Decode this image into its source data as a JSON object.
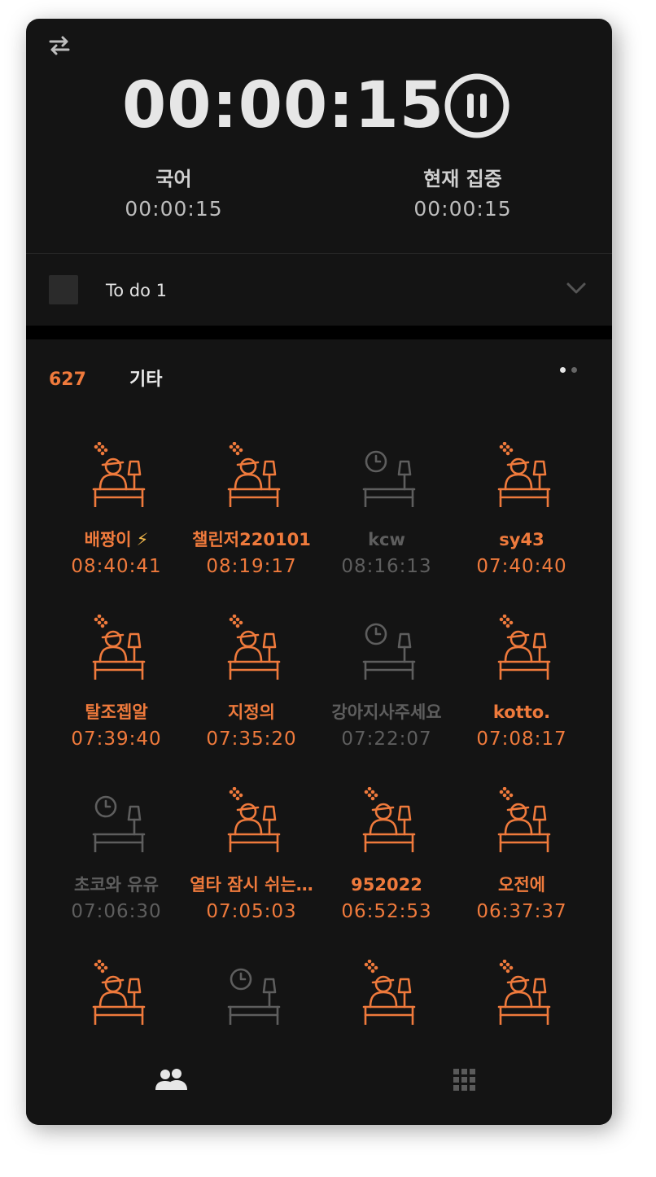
{
  "timer": {
    "main": "00:00:15",
    "subject_label": "국어",
    "subject_time": "00:00:15",
    "focus_label": "현재 집중",
    "focus_time": "00:00:15"
  },
  "todo": {
    "label": "To do 1"
  },
  "group": {
    "count": "627",
    "name": "기타"
  },
  "members": [
    {
      "name": "배짱이",
      "badge": "⚡",
      "time": "08:40:41",
      "active": true
    },
    {
      "name": "챌린저220101",
      "time": "08:19:17",
      "active": true
    },
    {
      "name": "kcw",
      "time": "08:16:13",
      "active": false
    },
    {
      "name": "sy43",
      "time": "07:40:40",
      "active": true
    },
    {
      "name": "탈조젭알",
      "time": "07:39:40",
      "active": true
    },
    {
      "name": "지정의",
      "time": "07:35:20",
      "active": true
    },
    {
      "name": "강아지사주세요",
      "time": "07:22:07",
      "active": false
    },
    {
      "name": "kotto.",
      "time": "07:08:17",
      "active": true
    },
    {
      "name": "초코와 유유",
      "time": "07:06:30",
      "active": false
    },
    {
      "name": "열타 잠시 쉬는…",
      "time": "07:05:03",
      "active": true
    },
    {
      "name": "952022",
      "time": "06:52:53",
      "active": true
    },
    {
      "name": "오전에",
      "time": "06:37:37",
      "active": true
    },
    {
      "name": "",
      "time": "",
      "active": true
    },
    {
      "name": "",
      "time": "",
      "active": false
    },
    {
      "name": "",
      "time": "",
      "active": true
    },
    {
      "name": "",
      "time": "",
      "active": true
    }
  ],
  "colors": {
    "accent": "#ef7a3c",
    "inactive": "#5e5e5e",
    "background": "#141414"
  },
  "icons": {
    "swap": "swap-arrows-icon",
    "pause": "pause-circle-icon",
    "chevron": "chevron-down-icon",
    "studying": "studying-person-icon",
    "idle": "empty-desk-clock-icon",
    "people": "people-icon",
    "grid": "grid-icon"
  }
}
